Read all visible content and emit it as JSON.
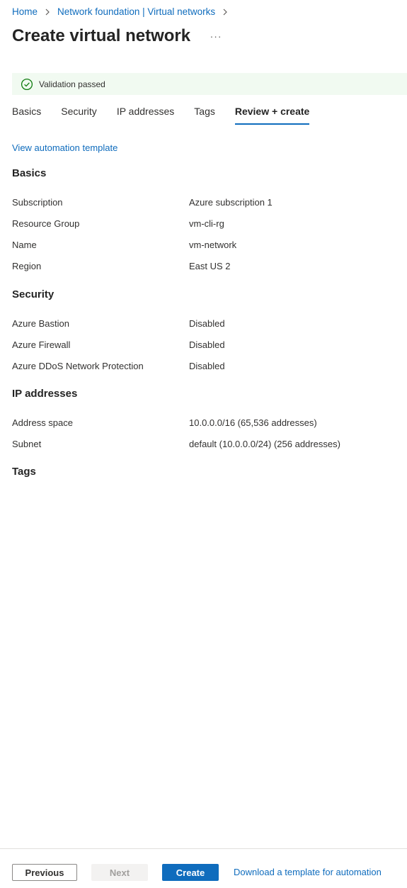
{
  "breadcrumb": {
    "home": "Home",
    "parent": "Network foundation | Virtual networks"
  },
  "header": {
    "title": "Create virtual network",
    "more": "···"
  },
  "validation": {
    "text": "Validation passed",
    "color": "#107c10"
  },
  "tabs": [
    "Basics",
    "Security",
    "IP addresses",
    "Tags",
    "Review + create"
  ],
  "active_tab": "Review + create",
  "links": {
    "view_template": "View automation template"
  },
  "sections": {
    "basics": {
      "title": "Basics",
      "rows": [
        {
          "label": "Subscription",
          "value": "Azure subscription 1"
        },
        {
          "label": "Resource Group",
          "value": "vm-cli-rg"
        },
        {
          "label": "Name",
          "value": "vm-network"
        },
        {
          "label": "Region",
          "value": "East US 2"
        }
      ]
    },
    "security": {
      "title": "Security",
      "rows": [
        {
          "label": "Azure Bastion",
          "value": "Disabled"
        },
        {
          "label": "Azure Firewall",
          "value": "Disabled"
        },
        {
          "label": "Azure DDoS Network Protection",
          "value": "Disabled"
        }
      ]
    },
    "ip": {
      "title": "IP addresses",
      "rows": [
        {
          "label": "Address space",
          "value": "10.0.0.0/16 (65,536 addresses)"
        },
        {
          "label": "Subnet",
          "value": "default (10.0.0.0/24) (256 addresses)"
        }
      ]
    },
    "tags": {
      "title": "Tags"
    }
  },
  "footer": {
    "previous": "Previous",
    "next": "Next",
    "create": "Create",
    "download": "Download a template for automation"
  },
  "colors": {
    "accent": "#0f6cbd",
    "success_bg": "#f1faf1"
  }
}
